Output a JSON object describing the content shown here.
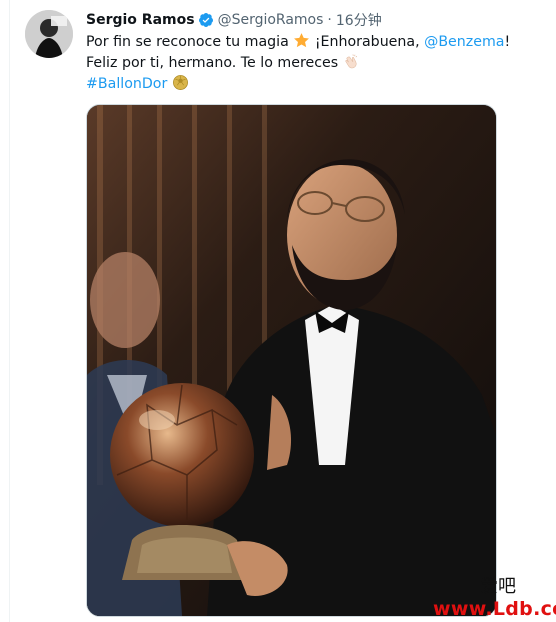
{
  "tweet": {
    "author_name": "Sergio Ramos",
    "handle": "@SergioRamos",
    "separator": "·",
    "time": "16分钟",
    "line1_text": "Por fin se reconoce tu magia",
    "line1_emoji": "star",
    "line1_text2": "¡Enhorabuena,",
    "mention": "@Benzema",
    "line1_end": "!",
    "line2_text": "Feliz por ti, hermano. Te lo mereces",
    "line2_emoji": "clapping-hands",
    "hashtag": "#BallonDor",
    "hashtag_emoji": "golden-ball"
  },
  "watermark": {
    "cn": "爱吧",
    "url": "www.Ldb.cc"
  },
  "colors": {
    "link": "#1d9bf0",
    "verified": "#1d9bf0",
    "watermark_red": "#e01010"
  }
}
